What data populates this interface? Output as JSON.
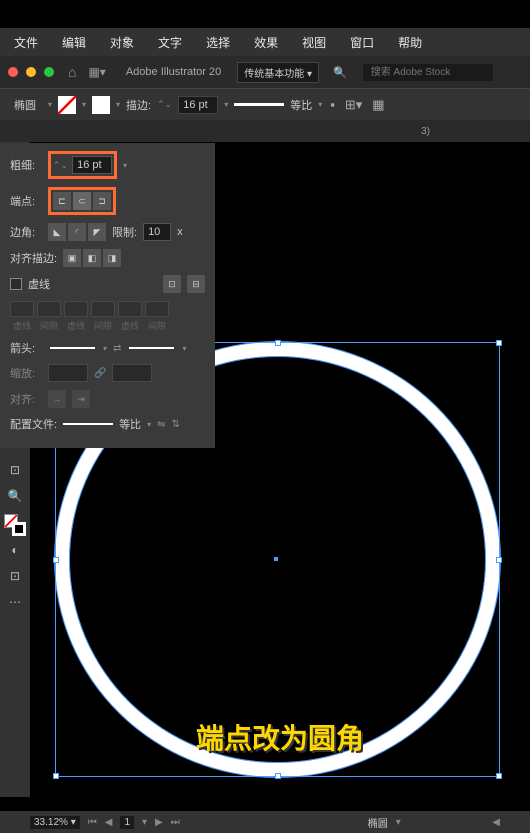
{
  "menu": [
    "文件",
    "编辑",
    "对象",
    "文字",
    "选择",
    "效果",
    "视图",
    "窗口",
    "帮助"
  ],
  "titlebar": {
    "app_name": "Adobe Illustrator 20",
    "workspace": "传统基本功能",
    "search_placeholder": "搜索 Adobe Stock"
  },
  "controlbar": {
    "shape": "椭圆",
    "stroke_label": "描边:",
    "stroke_pt": "16 pt",
    "scale_label": "等比"
  },
  "tab": {
    "suffix": "3)"
  },
  "stroke_panel": {
    "weight_label": "粗细:",
    "weight_value": "16 pt",
    "cap_label": "端点:",
    "corner_label": "边角:",
    "limit_label": "限制:",
    "limit_value": "10",
    "limit_x": "x",
    "align_label": "对齐描边:",
    "dashed_label": "虚线",
    "dash_cols": [
      "虚线",
      "间隙",
      "虚线",
      "间隙",
      "虚线",
      "间隙"
    ],
    "arrow_label": "箭头:",
    "scale_label": "缩放:",
    "align_arrow_label": "对齐:",
    "profile_label": "配置文件:",
    "profile_value": "等比"
  },
  "canvas": {
    "caption": "端点改为圆角"
  },
  "statusbar": {
    "zoom": "33.12%",
    "page": "1",
    "shape": "椭圆"
  }
}
